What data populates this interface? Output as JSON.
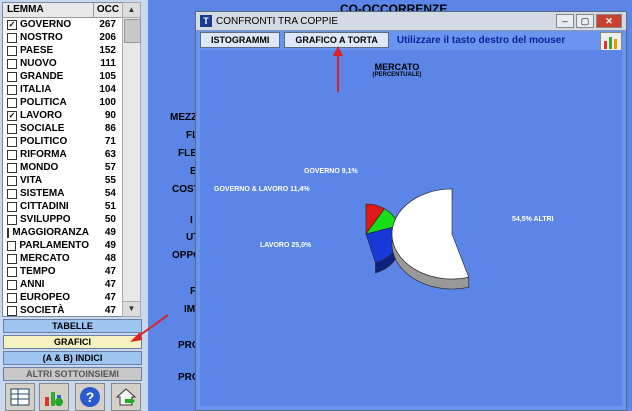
{
  "main": {
    "title": "CO-OCCORRENZE"
  },
  "bg_labels": [
    "MEZZ",
    "FL",
    "FLE",
    "E",
    "COST",
    "I",
    "UT",
    "OPPO",
    "F",
    "IMI",
    "PRO",
    "PRO"
  ],
  "table": {
    "headers": {
      "lemma": "LEMMA",
      "occ": "OCC"
    },
    "rows": [
      {
        "lemma": "GOVERNO",
        "occ": "267",
        "checked": true
      },
      {
        "lemma": "NOSTRO",
        "occ": "206",
        "checked": false
      },
      {
        "lemma": "PAESE",
        "occ": "152",
        "checked": false
      },
      {
        "lemma": "NUOVO",
        "occ": "111",
        "checked": false
      },
      {
        "lemma": "GRANDE",
        "occ": "105",
        "checked": false
      },
      {
        "lemma": "ITALIA",
        "occ": "104",
        "checked": false
      },
      {
        "lemma": "POLITICA",
        "occ": "100",
        "checked": false
      },
      {
        "lemma": "LAVORO",
        "occ": "90",
        "checked": true
      },
      {
        "lemma": "SOCIALE",
        "occ": "86",
        "checked": false
      },
      {
        "lemma": "POLITICO",
        "occ": "71",
        "checked": false
      },
      {
        "lemma": "RIFORMA",
        "occ": "63",
        "checked": false
      },
      {
        "lemma": "MONDO",
        "occ": "57",
        "checked": false
      },
      {
        "lemma": "VITA",
        "occ": "55",
        "checked": false
      },
      {
        "lemma": "SISTEMA",
        "occ": "54",
        "checked": false
      },
      {
        "lemma": "CITTADINI",
        "occ": "51",
        "checked": false
      },
      {
        "lemma": "SVILUPPO",
        "occ": "50",
        "checked": false
      },
      {
        "lemma": "MAGGIORANZA",
        "occ": "49",
        "checked": false
      },
      {
        "lemma": "PARLAMENTO",
        "occ": "49",
        "checked": false
      },
      {
        "lemma": "MERCATO",
        "occ": "48",
        "checked": false
      },
      {
        "lemma": "TEMPO",
        "occ": "47",
        "checked": false
      },
      {
        "lemma": "ANNI",
        "occ": "47",
        "checked": false
      },
      {
        "lemma": "EUROPEO",
        "occ": "47",
        "checked": false
      },
      {
        "lemma": "SOCIETÀ",
        "occ": "47",
        "checked": false
      }
    ]
  },
  "buttons": {
    "tabelle": "TABELLE",
    "grafici": "GRAFICI",
    "indici": "(A & B)  INDICI",
    "altri": "ALTRI SOTTOINSIEMI"
  },
  "icons": [
    "table-icon",
    "chart-icon",
    "help-icon",
    "home-icon"
  ],
  "dialog": {
    "title": "CONFRONTI TRA COPPIE",
    "buttons": {
      "istogrammi": "ISTOGRAMMI",
      "torta": "GRAFICO A TORTA"
    },
    "tip": "Utilizzare il tasto destro del mouser"
  },
  "chart_data": {
    "type": "pie",
    "title": "MERCATO",
    "subtitle": "(PERCENTUALE)",
    "slices": [
      {
        "label": "GOVERNO",
        "value": 9.1,
        "text": "GOVERNO  9,1%",
        "color": "#e01818"
      },
      {
        "label": "GOVERNO & LAVORO",
        "value": 11.4,
        "text": "GOVERNO & LAVORO  11,4%",
        "color": "#18e018"
      },
      {
        "label": "LAVORO",
        "value": 25.0,
        "text": "LAVORO  25,0%",
        "color": "#1838d8"
      },
      {
        "label": "ALTRI",
        "value": 54.5,
        "text": "54,5%  ALTRI",
        "color": "#ffffff"
      }
    ]
  }
}
